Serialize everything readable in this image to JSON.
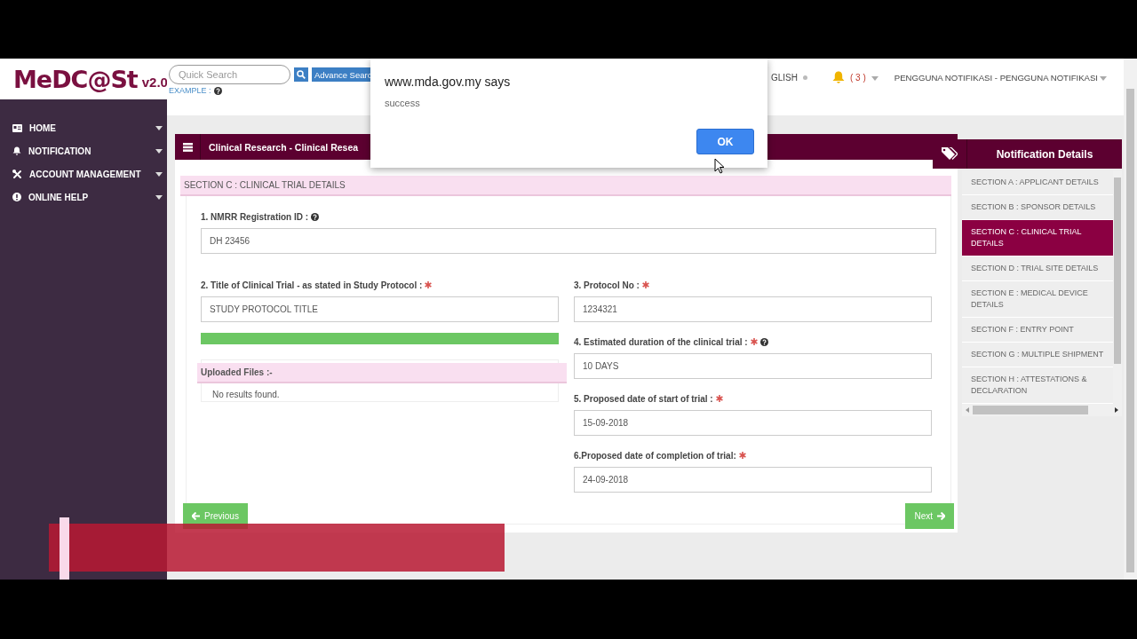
{
  "header": {
    "logo": "MeDC@St",
    "logo_version": "v2.0",
    "search": {
      "placeholder": "Quick Search"
    },
    "advance_search": "Advance Searc",
    "example": "EXAMPLE :",
    "language": "GLISH",
    "notification_count": "( 3 )",
    "user": "PENGGUNA NOTIFIKASI - PENGGUNA NOTIFIKASI"
  },
  "sidebar": {
    "items": [
      {
        "label": "HOME",
        "kind": "home"
      },
      {
        "label": "NOTIFICATION",
        "kind": "bell"
      },
      {
        "label": "ACCOUNT MANAGEMENT",
        "kind": "tools"
      },
      {
        "label": "ONLINE HELP",
        "kind": "info"
      }
    ]
  },
  "panel": {
    "title": "Clinical Research - Clinical Resea",
    "section_title": "SECTION C : CLINICAL TRIAL DETAILS",
    "registration": {
      "label": "1. NMRR Registration ID :",
      "value": "DH 23456",
      "required": false,
      "help": true
    },
    "title_field": {
      "label": "2. Title of Clinical Trial - as stated in Study Protocol :",
      "value": "STUDY PROTOCOL TITLE",
      "required": true,
      "help": false
    },
    "upload_progress": {
      "level": 1
    },
    "uploaded_files": {
      "title": "Uploaded Files :-",
      "empty_text": "No results found."
    },
    "right_fields": [
      {
        "label": "3. Protocol No :",
        "value": "1234321",
        "required": true,
        "help": false
      },
      {
        "label": "4. Estimated duration of the clinical trial :",
        "value": "10 DAYS",
        "required": true,
        "help": true
      },
      {
        "label": "5. Proposed date of start of trial :",
        "value": "15-09-2018",
        "required": true,
        "help": false
      },
      {
        "label": "6.Proposed date of completion of trial:",
        "value": "24-09-2018",
        "required": true,
        "help": false
      }
    ],
    "previous": "Previous",
    "next": "Next"
  },
  "details": {
    "title": "Notification Details",
    "items": [
      {
        "label": "SECTION A : APPLICANT DETAILS",
        "selected": false
      },
      {
        "label": "SECTION B : SPONSOR DETAILS",
        "selected": false
      },
      {
        "label": "SECTION C : CLINICAL TRIAL DETAILS",
        "selected": true
      },
      {
        "label": "SECTION D : TRIAL SITE DETAILS",
        "selected": false
      },
      {
        "label": "SECTION E : MEDICAL DEVICE DETAILS",
        "selected": false
      },
      {
        "label": "SECTION F : ENTRY POINT",
        "selected": false
      },
      {
        "label": "SECTION G : MULTIPLE SHIPMENT",
        "selected": false
      },
      {
        "label": "SECTION H : ATTESTATIONS & DECLARATION",
        "selected": false
      }
    ]
  },
  "dialog": {
    "title": "www.mda.gov.my says",
    "message": "success",
    "button": "OK"
  }
}
